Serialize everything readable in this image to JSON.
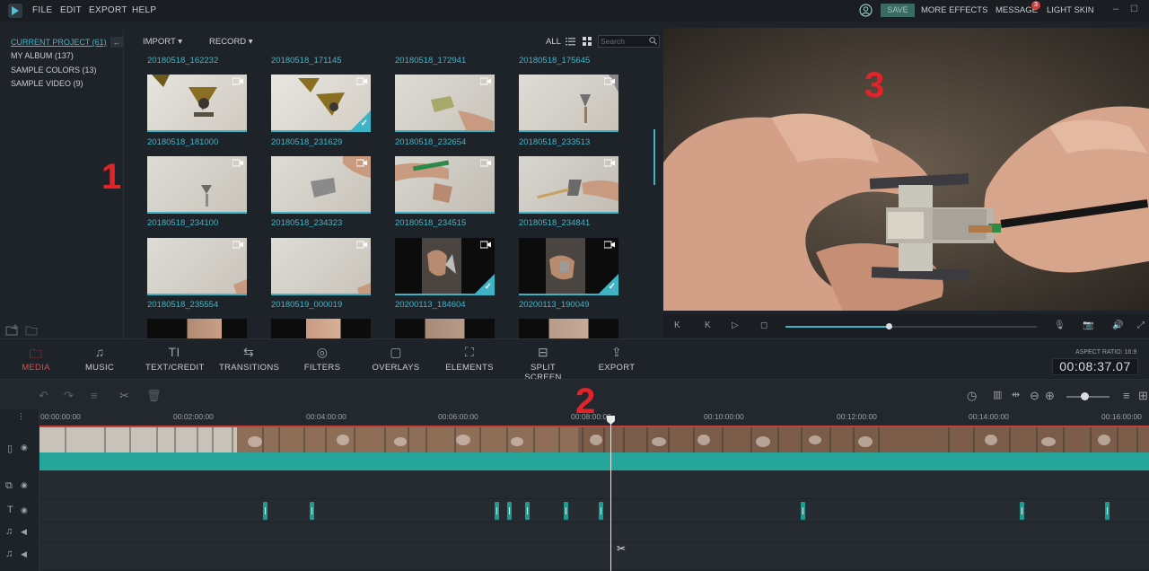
{
  "menu": {
    "file": "FILE",
    "edit": "EDIT",
    "export": "EXPORT",
    "help": "HELP"
  },
  "topbar": {
    "save": "SAVE",
    "more_effects": "MORE EFFECTS",
    "message": "MESSAGE",
    "message_count": "3",
    "light_skin": "LIGHT SKIN"
  },
  "sidebar": {
    "items": [
      {
        "label": "CURRENT PROJECT (61)"
      },
      {
        "label": "MY ALBUM (137)"
      },
      {
        "label": "SAMPLE COLORS (13)"
      },
      {
        "label": "SAMPLE VIDEO (9)"
      }
    ]
  },
  "media_toolbar": {
    "import": "IMPORT",
    "record": "RECORD",
    "all": "ALL",
    "search_placeholder": "Search"
  },
  "media": {
    "top_labels": [
      "20180518_162232",
      "20180518_171145",
      "20180518_172941",
      "20180518_175645"
    ],
    "rows": [
      [
        "20180518_181000",
        "20180518_231629",
        "20180518_232654",
        "20180518_233513"
      ],
      [
        "20180518_234100",
        "20180518_234323",
        "20180518_234515",
        "20180518_234841"
      ],
      [
        "20180518_235554",
        "20180519_000019",
        "20200113_184604",
        "20200113_190049"
      ]
    ]
  },
  "tabs": [
    {
      "label": "MEDIA",
      "icon": "folder-icon"
    },
    {
      "label": "MUSIC",
      "icon": "music-note-icon"
    },
    {
      "label": "TEXT/CREDIT",
      "icon": "text-icon"
    },
    {
      "label": "TRANSITIONS",
      "icon": "transition-icon"
    },
    {
      "label": "FILTERS",
      "icon": "filter-icon"
    },
    {
      "label": "OVERLAYS",
      "icon": "overlay-icon"
    },
    {
      "label": "ELEMENTS",
      "icon": "image-icon"
    },
    {
      "label": "SPLIT SCREEN",
      "icon": "split-screen-icon"
    },
    {
      "label": "EXPORT",
      "icon": "export-icon"
    }
  ],
  "aspect_ratio": "ASPECT RATIO: 16:9",
  "timecode": "00:08:37.07",
  "ruler": [
    "00:00:00:00",
    "00:02:00:00",
    "00:04:00:00",
    "00:06:00:00",
    "00:08:00:00",
    "00:10:00:00",
    "00:12:00:00",
    "00:14:00:00",
    "00:16:00:00"
  ],
  "annotations": {
    "one": "1",
    "two": "2",
    "three": "3"
  },
  "colors": {
    "accent": "#3fb2c5",
    "active_tab": "#e14a4a",
    "clip_green": "#26a69a",
    "annotation": "#e0242a"
  }
}
